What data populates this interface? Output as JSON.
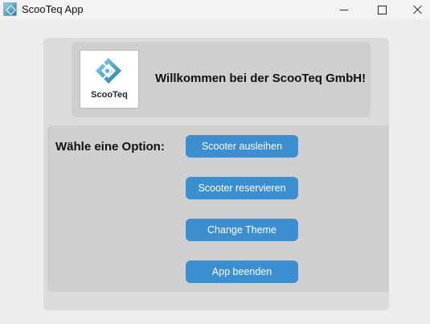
{
  "window": {
    "title": "ScooTeq App",
    "app_icon": "scooteq-app-icon",
    "controls": [
      "minimize-icon",
      "maximize-icon",
      "close-icon"
    ]
  },
  "header": {
    "logo_text": "ScooTeq",
    "welcome": "Willkommen bei der ScooTeq GmbH!"
  },
  "options": {
    "label": "Wähle eine Option:",
    "buttons": [
      {
        "label": "Scooter ausleihen"
      },
      {
        "label": "Scooter reservieren"
      },
      {
        "label": "Change Theme"
      },
      {
        "label": "App beenden"
      }
    ]
  },
  "colors": {
    "button": "#3b8ed0",
    "panel": "#cfcfcf",
    "frame": "#dbdbdb",
    "background": "#ececec"
  }
}
